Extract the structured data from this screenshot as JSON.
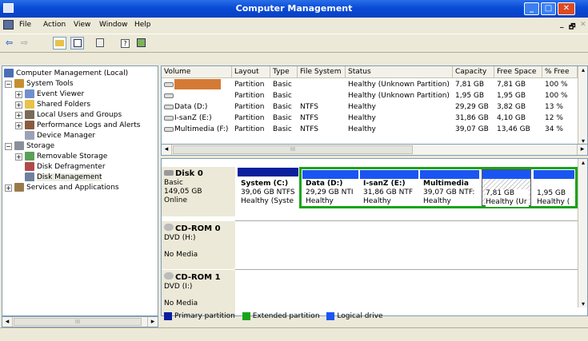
{
  "window": {
    "title": "Computer Management",
    "min": "_",
    "max": "□",
    "close": "✕",
    "doc_min": "_",
    "doc_max": "🗗",
    "doc_close": "✕"
  },
  "menu": [
    "File",
    "Action",
    "View",
    "Window",
    "Help"
  ],
  "toolbar": {
    "back": "⇦",
    "forward": "⇨"
  },
  "tree": {
    "root": "Computer Management (Local)",
    "items": [
      {
        "label": "System Tools",
        "exp": "−"
      },
      {
        "label": "Event Viewer",
        "exp": "+"
      },
      {
        "label": "Shared Folders",
        "exp": "+"
      },
      {
        "label": "Local Users and Groups",
        "exp": "+"
      },
      {
        "label": "Performance Logs and Alerts",
        "exp": "+"
      },
      {
        "label": "Device Manager",
        "exp": ""
      },
      {
        "label": "Storage",
        "exp": "−"
      },
      {
        "label": "Removable Storage",
        "exp": "+"
      },
      {
        "label": "Disk Defragmenter",
        "exp": ""
      },
      {
        "label": "Disk Management",
        "exp": ""
      },
      {
        "label": "Services and Applications",
        "exp": "+"
      }
    ]
  },
  "volumes": {
    "columns": [
      "Volume",
      "Layout",
      "Type",
      "File System",
      "Status",
      "Capacity",
      "Free Space",
      "% Free"
    ],
    "rows": [
      {
        "volume": "",
        "layout": "Partition",
        "type": "Basic",
        "fs": "",
        "status": "Healthy (Unknown Partition)",
        "capacity": "7,81 GB",
        "free": "7,81 GB",
        "pct": "100 %"
      },
      {
        "volume": "",
        "layout": "Partition",
        "type": "Basic",
        "fs": "",
        "status": "Healthy (Unknown Partition)",
        "capacity": "1,95 GB",
        "free": "1,95 GB",
        "pct": "100 %"
      },
      {
        "volume": "Data (D:)",
        "layout": "Partition",
        "type": "Basic",
        "fs": "NTFS",
        "status": "Healthy",
        "capacity": "29,29 GB",
        "free": "3,82 GB",
        "pct": "13 %"
      },
      {
        "volume": "I-sanZ (E:)",
        "layout": "Partition",
        "type": "Basic",
        "fs": "NTFS",
        "status": "Healthy",
        "capacity": "31,86 GB",
        "free": "4,10 GB",
        "pct": "12 %"
      },
      {
        "volume": "Multimedia (F:)",
        "layout": "Partition",
        "type": "Basic",
        "fs": "NTFS",
        "status": "Healthy",
        "capacity": "39,07 GB",
        "free": "13,46 GB",
        "pct": "34 %"
      }
    ],
    "scroll_thumb": "III"
  },
  "disks": [
    {
      "name": "Disk 0",
      "type": "Basic",
      "size": "149,05 GB",
      "state": "Online"
    },
    {
      "name": "CD-ROM 0",
      "type": "DVD (H:)",
      "state": "No Media"
    },
    {
      "name": "CD-ROM 1",
      "type": "DVD (I:)",
      "state": "No Media"
    }
  ],
  "partitions": [
    {
      "name": "System  (C:)",
      "size": "39,06 GB NTFS",
      "status": "Healthy (Syste"
    },
    {
      "name": "Data  (D:)",
      "size": "29,29 GB NTI",
      "status": "Healthy"
    },
    {
      "name": "I-sanZ  (E:)",
      "size": "31,86 GB NTF",
      "status": "Healthy"
    },
    {
      "name": "Multimedia",
      "size": "39,07 GB NTF:",
      "status": "Healthy"
    },
    {
      "name": "",
      "size": "7,81 GB",
      "status": "Healthy (Ur"
    },
    {
      "name": "",
      "size": "1,95 GB",
      "status": "Healthy ("
    }
  ],
  "legend": [
    {
      "label": "Primary partition",
      "color": "#0a1f9c"
    },
    {
      "label": "Extended partition",
      "color": "#1aa31a"
    },
    {
      "label": "Logical drive",
      "color": "#1a55f2"
    }
  ],
  "colors": {
    "title_bar": "#0a4bd6",
    "selection": "#d47a35",
    "extended_border": "#1aa31a"
  },
  "tree_scroll_thumb": "III"
}
